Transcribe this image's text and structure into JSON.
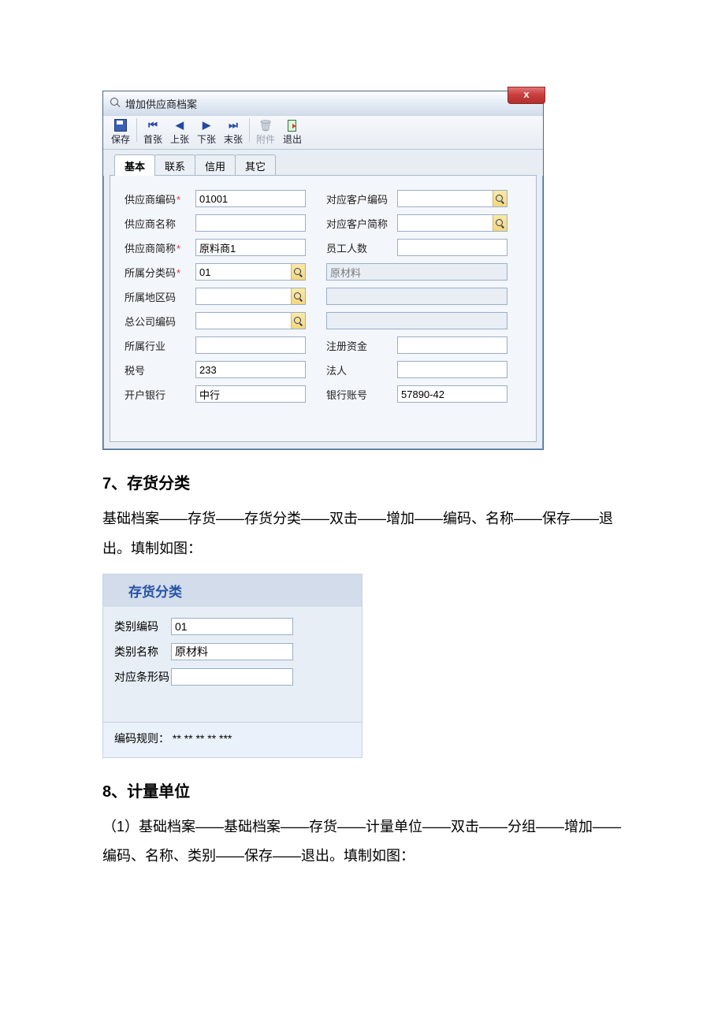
{
  "win": {
    "title": "增加供应商档案",
    "close": "x",
    "toolbar": {
      "save": "保存",
      "first": "首张",
      "prev": "上张",
      "next": "下张",
      "last": "末张",
      "attach": "附件",
      "exit": "退出"
    },
    "tabs": {
      "basic": "基本",
      "contact": "联系",
      "credit": "信用",
      "other": "其它"
    },
    "fields": {
      "vendor_code_label": "供应商编码",
      "vendor_code_value": "01001",
      "vendor_name_label": "供应商名称",
      "vendor_name_value": "",
      "vendor_short_label": "供应商简称",
      "vendor_short_value": "原料商1",
      "cat_code_label": "所属分类码",
      "cat_code_value": "01",
      "cat_name_value": "原材料",
      "region_code_label": "所属地区码",
      "region_code_value": "",
      "hq_code_label": "总公司编码",
      "hq_code_value": "",
      "industry_label": "所属行业",
      "industry_value": "",
      "tax_label": "税号",
      "tax_value": "233",
      "bank_label": "开户银行",
      "bank_value": "中行",
      "cust_code_label": "对应客户编码",
      "cust_code_value": "",
      "cust_short_label": "对应客户简称",
      "cust_short_value": "",
      "staff_label": "员工人数",
      "staff_value": "",
      "reg_cap_label": "注册资金",
      "reg_cap_value": "",
      "legal_label": "法人",
      "legal_value": "",
      "acct_label": "银行账号",
      "acct_value": "57890-42"
    }
  },
  "doc": {
    "h7": "7、存货分类",
    "p7": "基础档案——存货——存货分类——双击——增加——编码、名称——保存——退出。填制如图：",
    "h8": "8、计量单位",
    "p8": "（1）基础档案——基础档案——存货——计量单位——双击——分组——增加——编码、名称、类别——保存——退出。填制如图："
  },
  "panel2": {
    "title": "存货分类",
    "code_label": "类别编码",
    "code_value": "01",
    "name_label": "类别名称",
    "name_value": "原材料",
    "barcode_label": "对应条形码",
    "barcode_value": "",
    "rule": "编码规则：  ** ** ** ** ***"
  }
}
